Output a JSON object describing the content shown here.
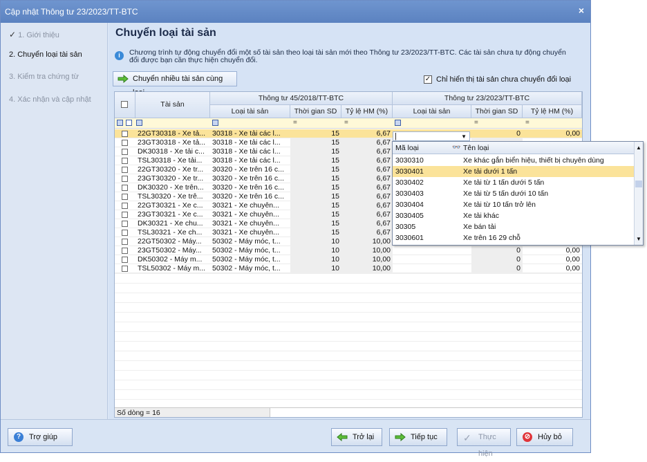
{
  "window": {
    "title": "Cập nhật Thông tư 23/2023/TT-BTC",
    "close_glyph": "×"
  },
  "sidebar": {
    "steps": [
      {
        "check": "✓",
        "label": "1. Giới thiệu"
      },
      {
        "label": "2. Chuyển loại tài sản"
      },
      {
        "label": "3. Kiểm tra chứng từ"
      },
      {
        "label": "4. Xác nhận và cập nhật"
      }
    ]
  },
  "main": {
    "title": "Chuyển loại tài sản",
    "info": "Chương trình tự động chuyển đổi một số tài sản theo loại tài sản mới theo Thông tư 23/2023/TT-BTC. Các tài sản chưa tự động chuyển đổi được bạn cần thực hiện chuyển đổi.",
    "multi_button": "Chuyển nhiều tài sản cùng loại",
    "show_unconverted": {
      "checked": true,
      "label": "Chỉ hiển thị tài sản chưa chuyển đổi loại"
    }
  },
  "grid": {
    "header": {
      "asset": "Tài sản",
      "group_old": "Thông tư 45/2018/TT-BTC",
      "group_new": "Thông tư 23/2023/TT-BTC",
      "old_type": "Loại tài sản",
      "old_time": "Thời gian SD",
      "old_rate": "Tỷ lệ HM (%)",
      "new_type": "Loại tài sản",
      "new_time": "Thời gian SD",
      "new_rate": "Tỷ lệ HM (%)"
    },
    "filter": {
      "eq": "="
    },
    "rows": [
      {
        "asset": "22GT30318 - Xe tả...",
        "old_type": "30318 - Xe tải các l...",
        "old_time": "15",
        "old_rate": "6,67",
        "new_type": "",
        "new_time": "0",
        "new_rate": "0,00"
      },
      {
        "asset": "23GT30318 - Xe tả...",
        "old_type": "30318 - Xe tải các l...",
        "old_time": "15",
        "old_rate": "6,67",
        "new_type": "",
        "new_time": "",
        "new_rate": ""
      },
      {
        "asset": "DK30318 - Xe tải c...",
        "old_type": "30318 - Xe tải các l...",
        "old_time": "15",
        "old_rate": "6,67",
        "new_type": "",
        "new_time": "",
        "new_rate": ""
      },
      {
        "asset": "TSL30318 - Xe tải...",
        "old_type": "30318 - Xe tải các l...",
        "old_time": "15",
        "old_rate": "6,67",
        "new_type": "",
        "new_time": "",
        "new_rate": ""
      },
      {
        "asset": "22GT30320 - Xe tr...",
        "old_type": "30320 - Xe trên 16 c...",
        "old_time": "15",
        "old_rate": "6,67",
        "new_type": "",
        "new_time": "",
        "new_rate": ""
      },
      {
        "asset": "23GT30320 - Xe tr...",
        "old_type": "30320 - Xe trên 16 c...",
        "old_time": "15",
        "old_rate": "6,67",
        "new_type": "",
        "new_time": "",
        "new_rate": ""
      },
      {
        "asset": "DK30320 - Xe trên...",
        "old_type": "30320 - Xe trên 16 c...",
        "old_time": "15",
        "old_rate": "6,67",
        "new_type": "",
        "new_time": "",
        "new_rate": ""
      },
      {
        "asset": "TSL30320 - Xe trê...",
        "old_type": "30320 - Xe trên 16 c...",
        "old_time": "15",
        "old_rate": "6,67",
        "new_type": "",
        "new_time": "",
        "new_rate": ""
      },
      {
        "asset": "22GT30321 - Xe c...",
        "old_type": "30321 - Xe chuyên...",
        "old_time": "15",
        "old_rate": "6,67",
        "new_type": "",
        "new_time": "",
        "new_rate": ""
      },
      {
        "asset": "23GT30321 - Xe c...",
        "old_type": "30321 - Xe chuyên...",
        "old_time": "15",
        "old_rate": "6,67",
        "new_type": "",
        "new_time": "",
        "new_rate": ""
      },
      {
        "asset": "DK30321 - Xe chu...",
        "old_type": "30321 - Xe chuyên...",
        "old_time": "15",
        "old_rate": "6,67",
        "new_type": "",
        "new_time": "",
        "new_rate": ""
      },
      {
        "asset": "TSL30321 - Xe ch...",
        "old_type": "30321 - Xe chuyên...",
        "old_time": "15",
        "old_rate": "6,67",
        "new_type": "",
        "new_time": "",
        "new_rate": ""
      },
      {
        "asset": "22GT50302 - Máy...",
        "old_type": "50302 - Máy móc, t...",
        "old_time": "10",
        "old_rate": "10,00",
        "new_type": "",
        "new_time": "0",
        "new_rate": "0,00"
      },
      {
        "asset": "23GT50302 - Máy...",
        "old_type": "50302 - Máy móc, t...",
        "old_time": "10",
        "old_rate": "10,00",
        "new_type": "",
        "new_time": "0",
        "new_rate": "0,00"
      },
      {
        "asset": "DK50302 - Máy m...",
        "old_type": "50302 - Máy móc, t...",
        "old_time": "10",
        "old_rate": "10,00",
        "new_type": "",
        "new_time": "0",
        "new_rate": "0,00"
      },
      {
        "asset": "TSL50302 - Máy m...",
        "old_type": "50302 - Máy móc, t...",
        "old_time": "10",
        "old_rate": "10,00",
        "new_type": "",
        "new_time": "0",
        "new_rate": "0,00"
      }
    ],
    "row_count": "Số dòng = 16"
  },
  "dropdown": {
    "col_code": "Mã loại",
    "col_name": "Tên loại",
    "items": [
      {
        "code": "3030310",
        "name": "Xe khác gắn biển hiệu, thiết bị chuyên dùng"
      },
      {
        "code": "3030401",
        "name": "Xe tải dưới 1 tấn"
      },
      {
        "code": "3030402",
        "name": "Xe tải từ 1 tấn  dưới 5 tấn"
      },
      {
        "code": "3030403",
        "name": "Xe tải từ 5 tấn  dưới 10 tấn"
      },
      {
        "code": "3030404",
        "name": "Xe tải từ 10 tấn trở lên"
      },
      {
        "code": "3030405",
        "name": "Xe tải khác"
      },
      {
        "code": "30305",
        "name": "Xe bán tải"
      },
      {
        "code": "3030601",
        "name": "Xe trên 16  29 chỗ"
      }
    ]
  },
  "buttons": {
    "help": "Trợ giúp",
    "back": "Trở lại",
    "next": "Tiếp tục",
    "execute": "Thực hiện",
    "cancel": "Hủy bỏ"
  },
  "colors": {
    "accent": "#5b82c0",
    "selected_row": "#fbe39a",
    "filter_row": "#fff9d8"
  }
}
